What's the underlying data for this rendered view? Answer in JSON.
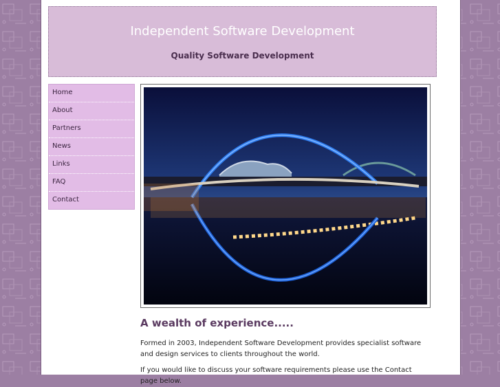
{
  "header": {
    "title": "Independent Software Development",
    "tagline": "Quality Software Development"
  },
  "nav": {
    "items": [
      {
        "label": "Home"
      },
      {
        "label": "About"
      },
      {
        "label": "Partners"
      },
      {
        "label": "News"
      },
      {
        "label": "Links"
      },
      {
        "label": "FAQ"
      },
      {
        "label": "Contact"
      }
    ]
  },
  "main": {
    "heading": "A wealth of experience.....",
    "paragraph1": "Formed in 2003, Independent Software Development provides specialist software and design services to clients throughout the world.",
    "paragraph2": "If you would like to discuss your software requirements please use the Contact page below."
  },
  "colors": {
    "background": "#9c7fa3",
    "header_bg": "#d8bcd8",
    "nav_bg": "#e2bce6",
    "heading": "#5a3a60"
  }
}
